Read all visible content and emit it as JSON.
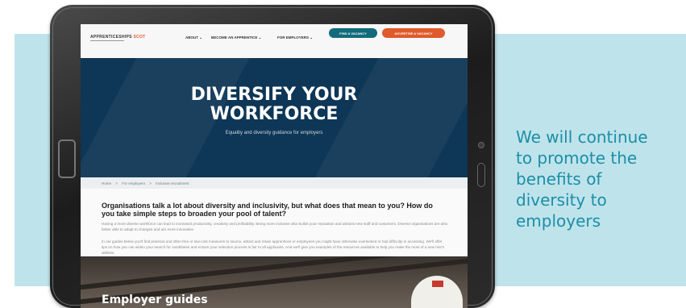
{
  "caption": {
    "lines": [
      "We will continue",
      "to promote the",
      "benefits of",
      "diversity to",
      "employers"
    ]
  },
  "site": {
    "logo_text": "APPRENTICESHIPS",
    "logo_accent": "SCOT",
    "nav": {
      "about": "ABOUT ⌄",
      "become": "BECOME AN APPRENTICE ⌄",
      "employers": "FOR EMPLOYERS ⌄"
    },
    "buttons": {
      "find": "FIND A VACANCY",
      "advertise": "ADVERTISE A VACANCY"
    },
    "hero": {
      "title_line1": "DIVERSIFY YOUR",
      "title_line2": "WORKFORCE",
      "subtitle": "Equality and diversity guidance for employers"
    },
    "breadcrumb": [
      "Home",
      ">",
      "For employers",
      ">",
      "Inclusive recruitment"
    ],
    "headline": "Organisations talk a lot about diversity and inclusivity, but what does that mean to you? How do you take simple steps to broaden your pool of talent?",
    "para1": "Having a more diverse workforce can lead to increased productivity, creativity and profitability. Being more inclusive also builds your reputation and attracts new staff and customers. Diverse organisations are also better able to adapt to changes and are more innovative.",
    "para2": "In our guides below you'll find practical and often free or low-cost measures to source, attract and retain apprentices or employees you might have otherwise overlooked or had difficulty in accessing. We'll offer tips on how you can widen your search for candidates and ensure your selection process is fair to all applicants. And we'll give you examples of the resources available to help you make the most of a new hire's abilities.",
    "section_title": "Employer guides"
  },
  "colors": {
    "panel": "#bfe3ea",
    "caption_text": "#1a8fa8",
    "hero_bg": "#0e3656",
    "find_button": "#126b7c",
    "advertise_button": "#e05a2c"
  }
}
